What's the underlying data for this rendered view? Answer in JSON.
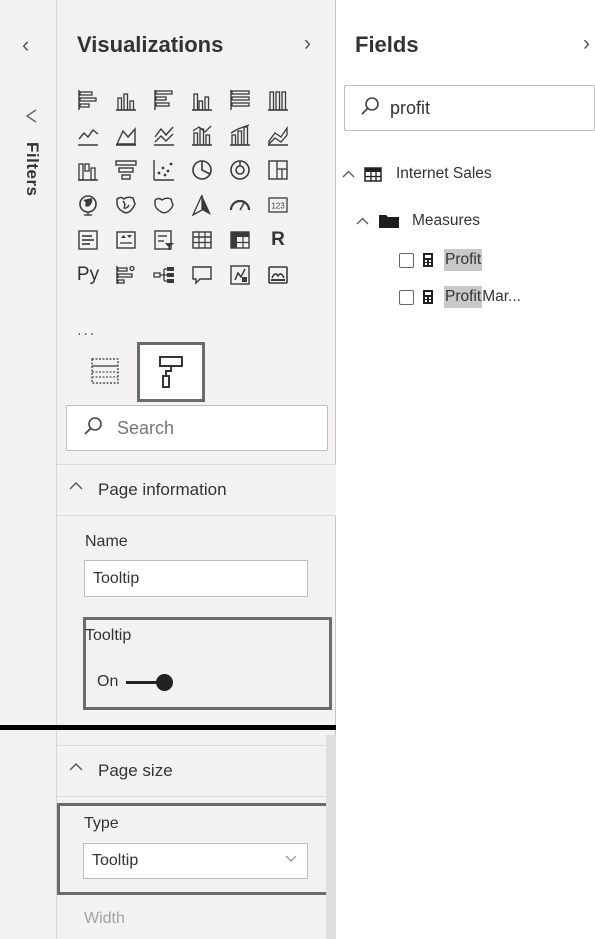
{
  "filters": {
    "collapse_glyph": "‹",
    "label": "Filters"
  },
  "visualizations": {
    "title": "Visualizations",
    "expand_glyph": "›",
    "icons": [
      "stacked-bar-chart-icon",
      "stacked-column-chart-icon",
      "clustered-bar-chart-icon",
      "clustered-column-chart-icon",
      "100-stacked-bar-chart-icon",
      "100-stacked-column-chart-icon",
      "line-chart-icon",
      "area-chart-icon",
      "stacked-area-chart-icon",
      "line-clustered-column-chart-icon",
      "line-stacked-column-chart-icon",
      "ribbon-chart-icon",
      "waterfall-chart-icon",
      "funnel-chart-icon",
      "scatter-chart-icon",
      "pie-chart-icon",
      "donut-chart-icon",
      "treemap-icon",
      "map-icon",
      "filled-map-icon",
      "shape-map-icon",
      "azure-map-icon",
      "gauge-icon",
      "card-icon",
      "multi-row-card-icon",
      "kpi-icon",
      "slicer-icon",
      "table-icon",
      "matrix-icon",
      "r-visual-icon",
      "python-visual-icon",
      "key-influencers-icon",
      "decomposition-tree-icon",
      "qa-icon",
      "smart-narrative-icon",
      "paginated-report-icon"
    ],
    "r_label": "R",
    "py_label": "Py",
    "more_label": "...",
    "search_placeholder": "Search",
    "page_information": {
      "header": "Page information",
      "name_label": "Name",
      "name_value": "Tooltip",
      "tooltip_label": "Tooltip",
      "tooltip_state": "On"
    },
    "page_size": {
      "header": "Page size",
      "type_label": "Type",
      "type_value": "Tooltip",
      "width_label": "Width"
    }
  },
  "fields": {
    "title": "Fields",
    "expand_glyph": "›",
    "search_value": "profit",
    "table_name": "Internet Sales",
    "folder_name": "Measures",
    "items": [
      {
        "highlight": "Profit",
        "rest": ""
      },
      {
        "highlight": "Profit",
        "rest": " Mar..."
      }
    ]
  }
}
